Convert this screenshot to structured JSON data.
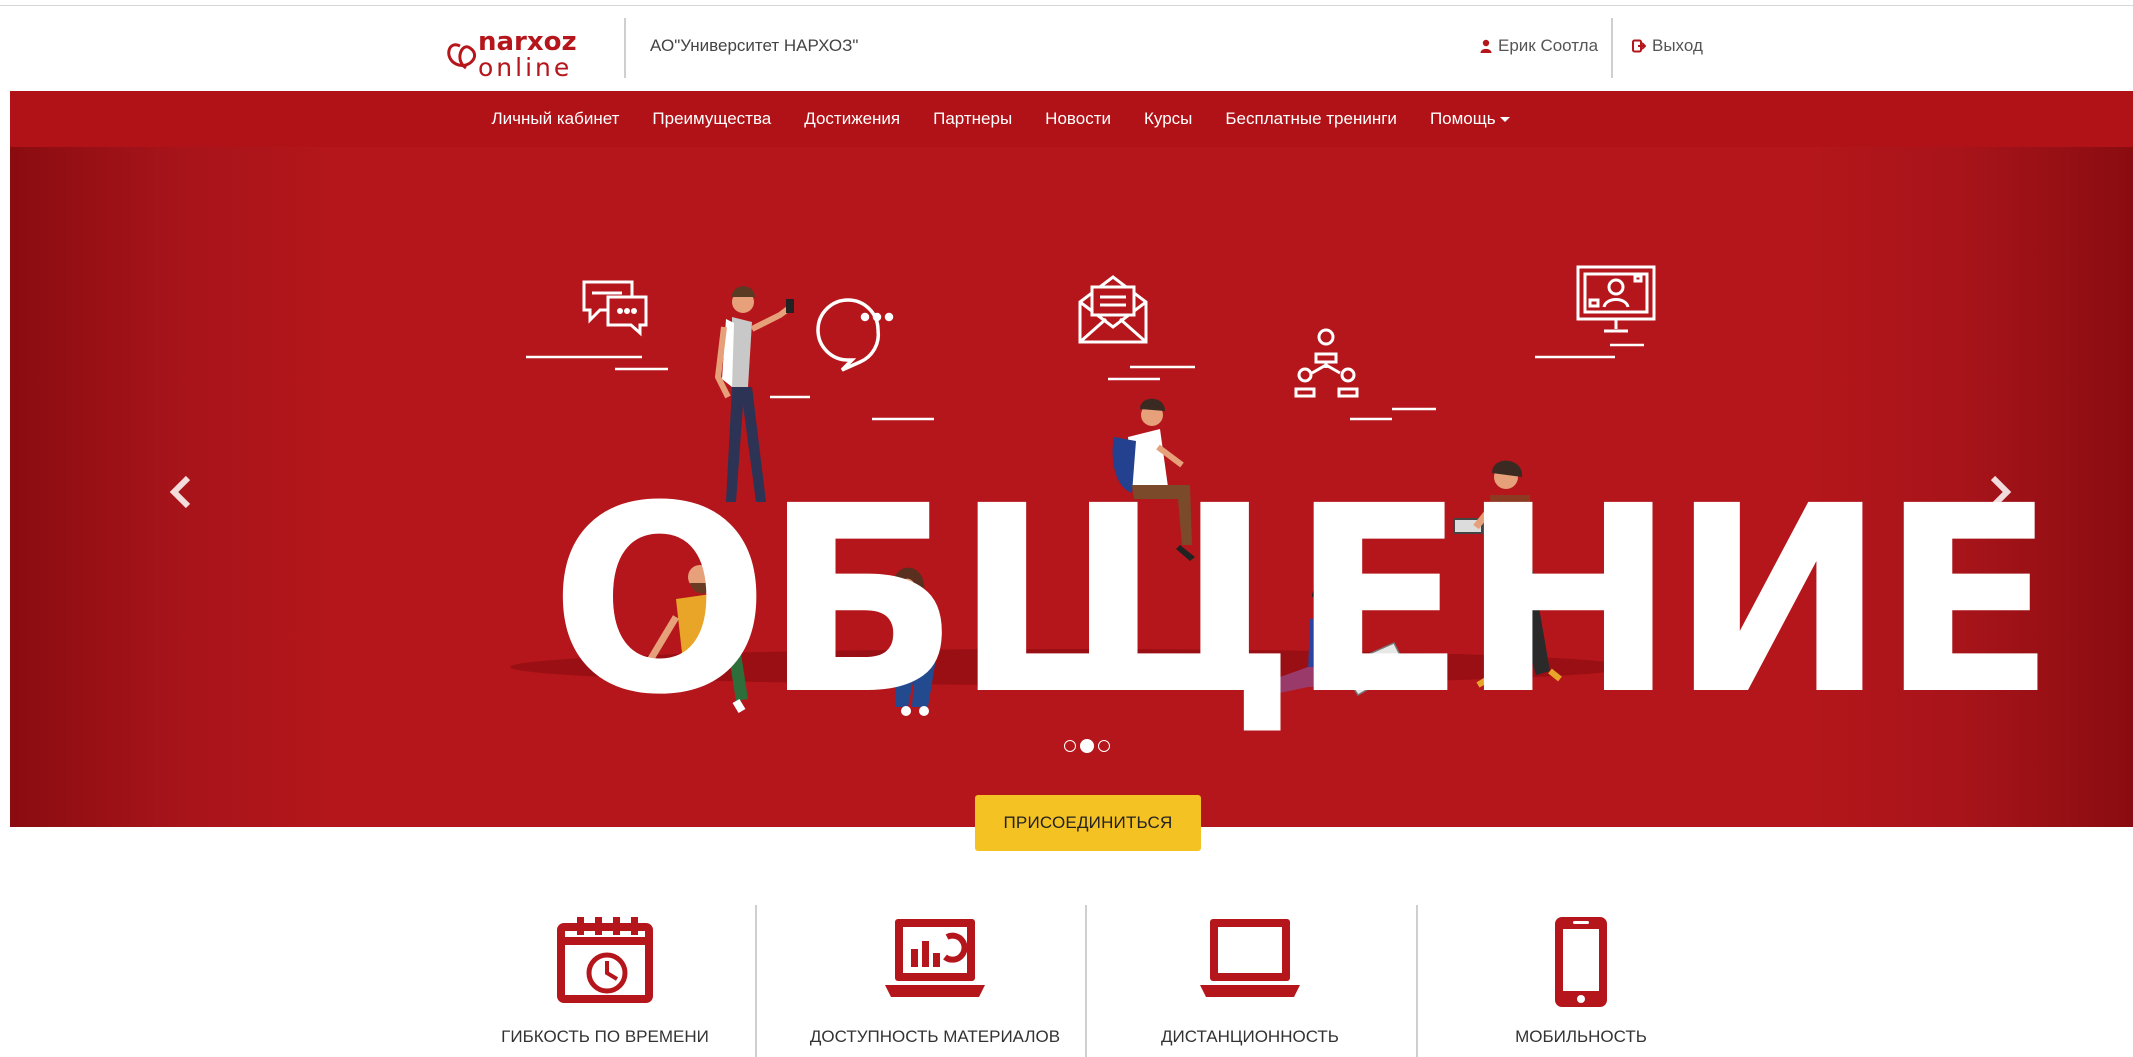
{
  "header": {
    "logo_top": "narxoz",
    "logo_bottom": "online",
    "organization": "АО\"Университет НАРХОЗ\"",
    "user_name": "Ерик Соотла",
    "logout_label": "Выход"
  },
  "nav": {
    "items": [
      {
        "label": "Личный кабинет"
      },
      {
        "label": "Преимущества"
      },
      {
        "label": "Достижения"
      },
      {
        "label": "Партнеры"
      },
      {
        "label": "Новости"
      },
      {
        "label": "Курсы"
      },
      {
        "label": "Бесплатные тренинги"
      },
      {
        "label": "Помощь"
      }
    ]
  },
  "hero": {
    "headline": "ОБЩЕНИЕ",
    "slide_count": 3,
    "active_slide": 2,
    "join_label": "ПРИСОЕДИНИТЬСЯ"
  },
  "features": [
    {
      "label": "ГИБКОСТЬ ПО ВРЕМЕНИ",
      "icon": "calendar-clock-icon"
    },
    {
      "label": "ДОСТУПНОСТЬ МАТЕРИАЛОВ",
      "icon": "laptop-chart-icon"
    },
    {
      "label": "ДИСТАНЦИОННОСТЬ",
      "icon": "laptop-icon"
    },
    {
      "label": "МОБИЛЬНОСТЬ",
      "icon": "smartphone-icon"
    }
  ],
  "colors": {
    "brand_red": "#b11217",
    "accent_yellow": "#f5c223",
    "icon_red": "#b5161b"
  }
}
